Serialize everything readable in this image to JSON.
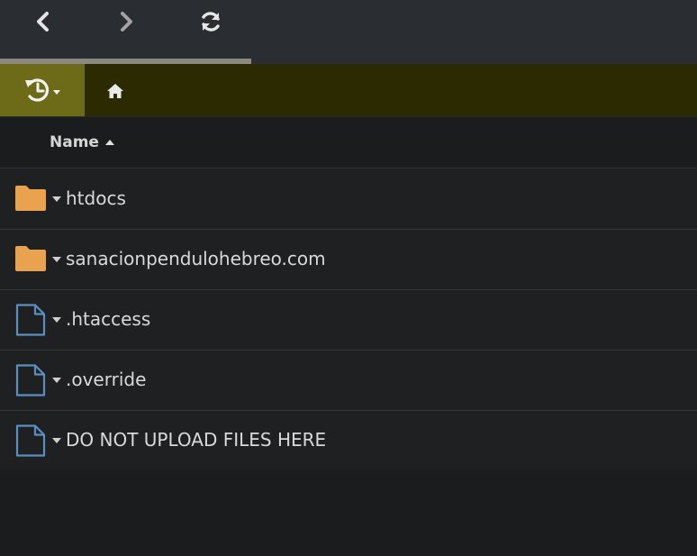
{
  "toolbar": {
    "back_icon": "chevron-left-icon",
    "forward_icon": "chevron-right-icon",
    "refresh_icon": "refresh-icon"
  },
  "loading_progress_percent": 36,
  "pathbar": {
    "history_icon": "history-icon",
    "home_icon": "home-icon"
  },
  "header": {
    "sort_label": "Name",
    "sort_direction": "ascending"
  },
  "files": [
    {
      "name": "htdocs",
      "type": "folder"
    },
    {
      "name": "sanacionpendulohebreo.com",
      "type": "folder"
    },
    {
      "name": ".htaccess",
      "type": "file"
    },
    {
      "name": ".override",
      "type": "file"
    },
    {
      "name": "DO NOT UPLOAD FILES HERE",
      "type": "file"
    }
  ],
  "colors": {
    "folder": "#e9a24d",
    "file": "#5b8fc0",
    "pathbar": "#2c2a00",
    "history_button": "#6d6b18",
    "background": "#1b1c1e"
  }
}
